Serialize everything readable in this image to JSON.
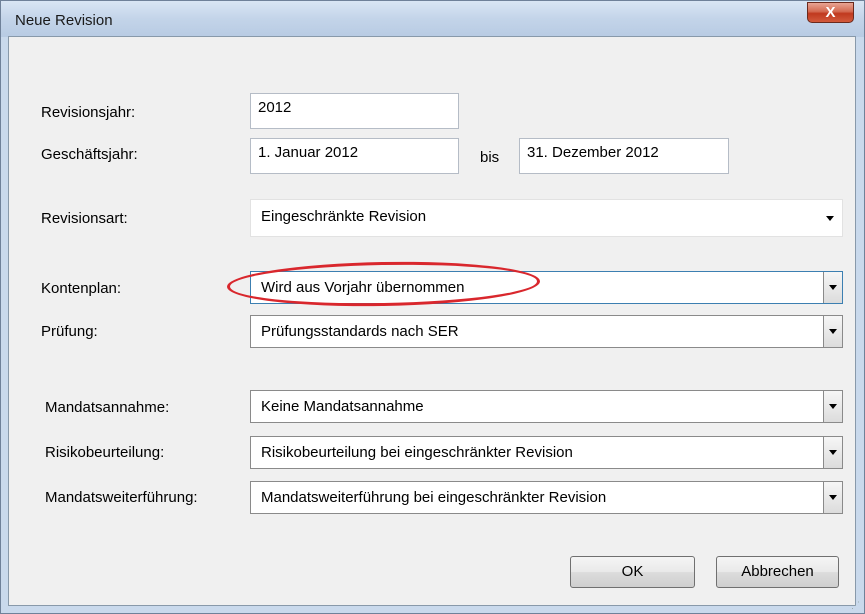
{
  "window": {
    "title": "Neue Revision",
    "close_label": "X"
  },
  "form": {
    "revisionsjahr": {
      "label": "Revisionsjahr:",
      "value": "2012"
    },
    "geschaeftsjahr": {
      "label": "Geschäftsjahr:",
      "from": "1. Januar 2012",
      "separator": "bis",
      "to": "31. Dezember 2012"
    },
    "revisionsart": {
      "label": "Revisionsart:",
      "value": "Eingeschränkte Revision"
    },
    "kontenplan": {
      "label": "Kontenplan:",
      "value": "Wird aus Vorjahr übernommen"
    },
    "pruefung": {
      "label": "Prüfung:",
      "value": "Prüfungsstandards nach SER"
    },
    "mandatsannahme": {
      "label": "Mandatsannahme:",
      "value": "Keine Mandatsannahme"
    },
    "risikobeurteilung": {
      "label": "Risikobeurteilung:",
      "value": "Risikobeurteilung bei eingeschränkter Revision"
    },
    "mandatsweiterfuehrung": {
      "label": "Mandatsweiterführung:",
      "value": "Mandatsweiterführung bei eingeschränkter Revision"
    }
  },
  "buttons": {
    "ok": "OK",
    "cancel": "Abbrechen"
  },
  "colors": {
    "highlight_oval": "#d9272d",
    "title_bar": "#c3d4e9",
    "close_button": "#c0391f"
  }
}
